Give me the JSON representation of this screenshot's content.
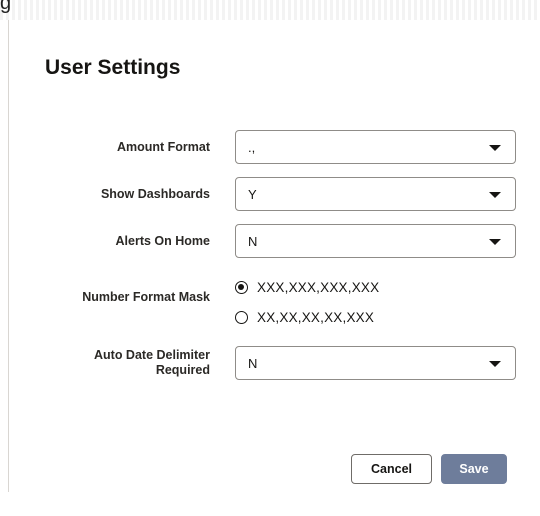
{
  "dialog": {
    "title": "User Settings",
    "top_char": "g"
  },
  "fields": {
    "amount_format": {
      "label": "Amount Format",
      "value": ".,"
    },
    "show_dashboards": {
      "label": "Show Dashboards",
      "value": "Y"
    },
    "alerts_on_home": {
      "label": "Alerts On Home",
      "value": "N"
    },
    "number_format_mask": {
      "label": "Number Format Mask",
      "options": [
        "XXX,XXX,XXX,XXX",
        "XX,XX,XX,XX,XXX"
      ],
      "selected": "XXX,XXX,XXX,XXX"
    },
    "auto_date_delimiter": {
      "label_line1": "Auto Date Delimiter",
      "label_line2": "Required",
      "value": "N"
    }
  },
  "actions": {
    "cancel_label": "Cancel",
    "save_label": "Save"
  },
  "colors": {
    "save_button": "#6e7d9b",
    "border": "#8f8c88",
    "text": "#161513"
  },
  "icons": {
    "dropdown": "caret-down-icon",
    "radio_on": "radio-checked-icon",
    "radio_off": "radio-unchecked-icon"
  }
}
